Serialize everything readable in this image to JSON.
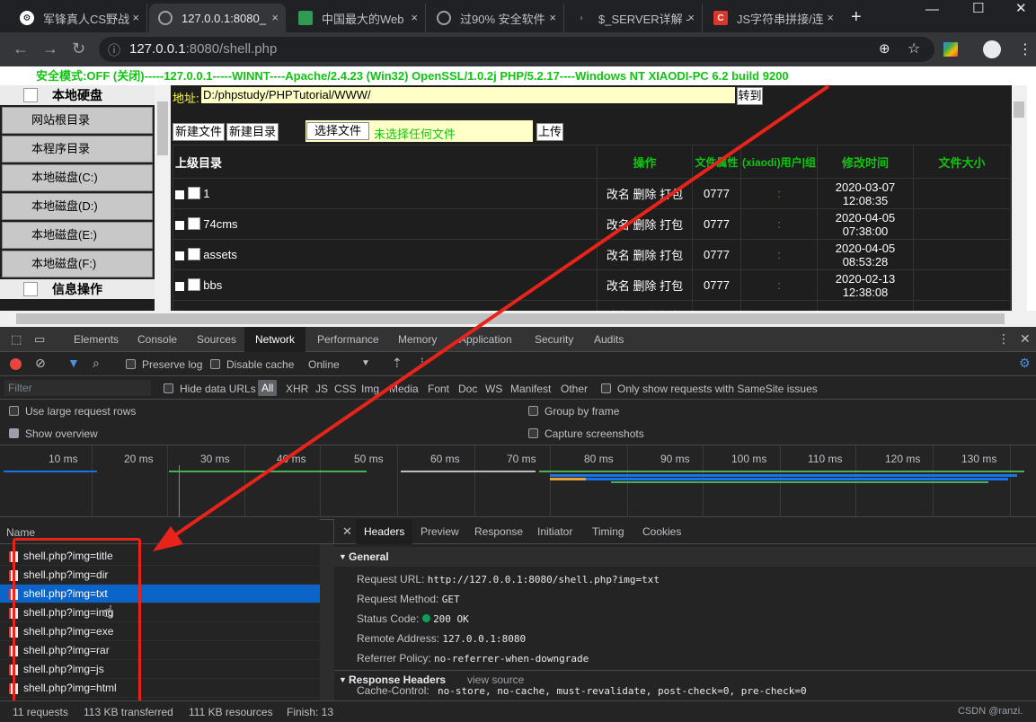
{
  "browser": {
    "tabs": [
      {
        "title": "军锋真人CS野战",
        "icon_color": "#ffffff"
      },
      {
        "title": "127.0.0.1:8080_",
        "icon_color": "#9aa0a6"
      },
      {
        "title": "中国最大的Web",
        "icon_color": "#2e9a52"
      },
      {
        "title": "过90% 安全软件",
        "icon_color": "#9aa0a6"
      },
      {
        "title": "$_SERVER详解 -",
        "icon_color": "#5f6368"
      },
      {
        "title": "JS字符串拼接/连",
        "icon_color": "#d9372a"
      }
    ],
    "tab_close": "×",
    "new_tab": "+",
    "url_host": "127.0.0.1",
    "url_rest": ":8080/shell.php"
  },
  "page": {
    "status_line": "安全模式:OFF (关闭)-----127.0.0.1-----WINNT----Apache/2.4.23 (Win32) OpenSSL/1.0.2j PHP/5.2.17----Windows NT XIAODI-PC 6.2 build 9200",
    "nav_sections": [
      {
        "title": "本地硬盘"
      },
      {
        "title": "信息操作"
      }
    ],
    "nav_items": [
      "网站根目录",
      "本程序目录",
      "本地磁盘(C:)",
      "本地磁盘(D:)",
      "本地磁盘(E:)",
      "本地磁盘(F:)"
    ],
    "address_label": "地址:",
    "address_value": "D:/phpstudy/PHPTutorial/WWW/",
    "goto_label": "转到",
    "new_file_label": "新建文件",
    "new_dir_label": "新建目录",
    "choose_file_label": "选择文件",
    "no_file_label": "未选择任何文件",
    "upload_label": "上传",
    "table_headers": {
      "parent": "上级目录",
      "ops": "操作",
      "attr": "文件属性",
      "owner": "(xiaodi)用户|组",
      "mtime": "修改时间",
      "size": "文件大小"
    },
    "rows": [
      {
        "name": "1",
        "ops": "改名 删除 打包",
        "perm": "0777",
        "owner": ":",
        "mtime": "2020-03-07 12:08:35"
      },
      {
        "name": "74cms",
        "ops": "改名 删除 打包",
        "perm": "0777",
        "owner": ":",
        "mtime": "2020-04-05 07:38:00"
      },
      {
        "name": "assets",
        "ops": "改名 删除 打包",
        "perm": "0777",
        "owner": ":",
        "mtime": "2020-04-05 08:53:28"
      },
      {
        "name": "bbs",
        "ops": "改名 删除 打包",
        "perm": "0777",
        "owner": ":",
        "mtime": "2020-02-13 12:38:08"
      },
      {
        "name": "",
        "ops": "改名 删除 打包",
        "perm": "",
        "owner": "",
        "mtime": "2020-04-07 0"
      }
    ]
  },
  "devtools": {
    "tabs": [
      "Elements",
      "Console",
      "Sources",
      "Network",
      "Performance",
      "Memory",
      "Application",
      "Security",
      "Audits"
    ],
    "active_tab": "Network",
    "preserve_log": "Preserve log",
    "disable_cache": "Disable cache",
    "throttle": "Online",
    "filter_placeholder": "Filter",
    "hide_data_urls": "Hide data URLs",
    "types": [
      "All",
      "XHR",
      "JS",
      "CSS",
      "Img",
      "Media",
      "Font",
      "Doc",
      "WS",
      "Manifest",
      "Other"
    ],
    "samesite": "Only show requests with SameSite issues",
    "large_rows": "Use large request rows",
    "group_by_frame": "Group by frame",
    "show_overview": "Show overview",
    "capture_screenshots": "Capture screenshots",
    "ticks": [
      "10 ms",
      "20 ms",
      "30 ms",
      "40 ms",
      "50 ms",
      "60 ms",
      "70 ms",
      "80 ms",
      "90 ms",
      "100 ms",
      "110 ms",
      "120 ms",
      "130 ms"
    ],
    "name_header": "Name",
    "requests": [
      "shell.php?img=title",
      "shell.php?img=dir",
      "shell.php?img=txt",
      "shell.php?img=img",
      "shell.php?img=exe",
      "shell.php?img=rar",
      "shell.php?img=js",
      "shell.php?img=html"
    ],
    "selected_request": "shell.php?img=txt",
    "detail_tabs": [
      "Headers",
      "Preview",
      "Response",
      "Initiator",
      "Timing",
      "Cookies"
    ],
    "general_title": "General",
    "general": [
      {
        "k": "Request URL:",
        "v": "http://127.0.0.1:8080/shell.php?img=txt"
      },
      {
        "k": "Request Method:",
        "v": "GET"
      },
      {
        "k": "Status Code:",
        "v": "200 OK"
      },
      {
        "k": "Remote Address:",
        "v": "127.0.0.1:8080"
      },
      {
        "k": "Referrer Policy:",
        "v": "no-referrer-when-downgrade"
      }
    ],
    "response_headers_title": "Response Headers",
    "view_source": "view source",
    "cache_control": {
      "k": "Cache-Control:",
      "v": "no-store, no-cache, must-revalidate, post-check=0, pre-check=0"
    },
    "summary": {
      "requests": "11 requests",
      "transferred": "113 KB transferred",
      "resources": "111 KB resources",
      "finish": "Finish: 13"
    },
    "watermark": "CSDN @ranzi."
  }
}
